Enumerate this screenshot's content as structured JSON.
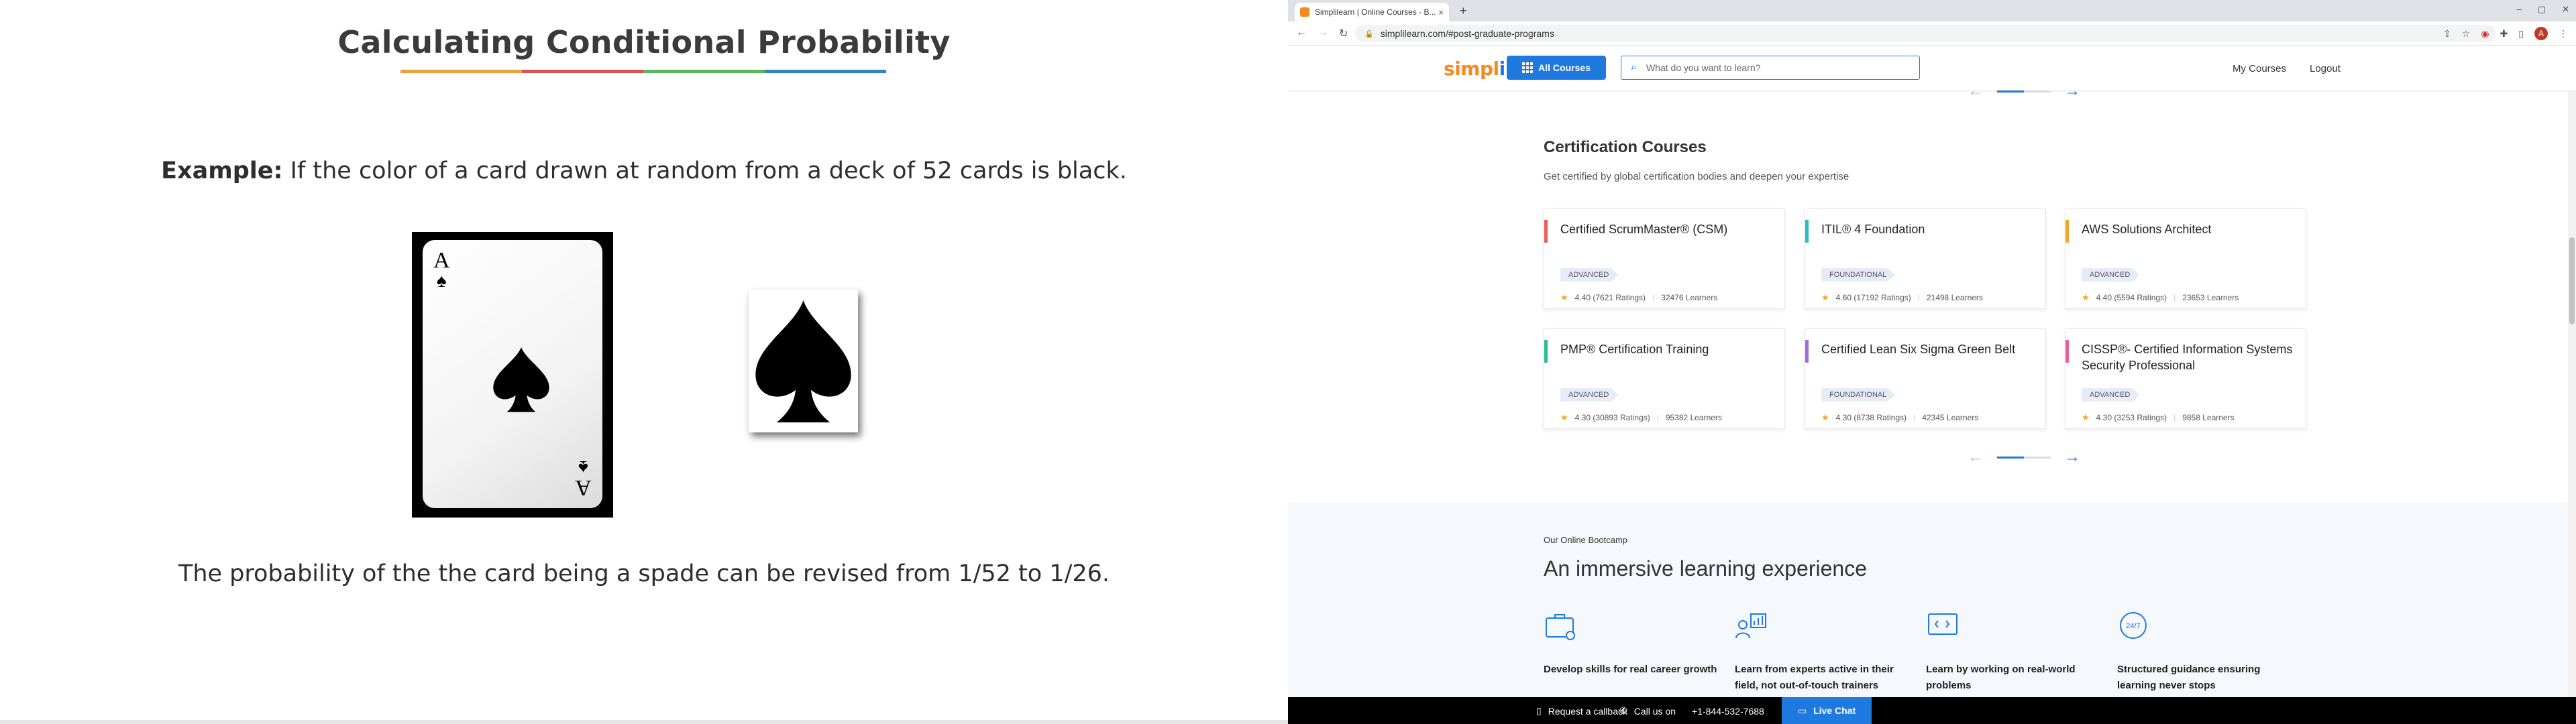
{
  "slide": {
    "title": "Calculating Conditional Probability",
    "example_label": "Example:",
    "example_text": " If the color of a card drawn at random from a deck of 52 cards is black.",
    "card_rank": "A",
    "conclusion": "The probability of the the card being a spade can be revised from 1/52 to 1/26.",
    "underline_colors": [
      "#e8a33d",
      "#d9534f",
      "#5bb85b",
      "#2e86c1"
    ]
  },
  "browser": {
    "tab_title": "Simplilearn | Online Courses - B...",
    "tab_close": "×",
    "new_tab": "+",
    "url": "simplilearn.com/#post-graduate-programs",
    "avatar_letter": "A",
    "window_controls": [
      "–",
      "▢",
      "✕"
    ]
  },
  "header": {
    "logo_text": "simpl",
    "logo_accent": "i",
    "logo_rest": "learn",
    "all_courses": "All Courses",
    "search_placeholder": "What do you want to learn?",
    "my_courses": "My Courses",
    "logout": "Logout"
  },
  "certification": {
    "title": "Certification Courses",
    "subtitle": "Get certified by global certification bodies and deepen your expertise",
    "courses": [
      {
        "name": "Certified ScrumMaster® (CSM)",
        "level": "ADVANCED",
        "rating": "4.40 (7621 Ratings)",
        "learners": "32476 Learners",
        "accent": "#e95f5f"
      },
      {
        "name": "ITIL® 4 Foundation",
        "level": "FOUNDATIONAL",
        "rating": "4.60 (17192 Ratings)",
        "learners": "21498 Learners",
        "accent": "#2bbcc9"
      },
      {
        "name": "AWS Solutions Architect",
        "level": "ADVANCED",
        "rating": "4.40 (5594 Ratings)",
        "learners": "23653 Learners",
        "accent": "#f5a623"
      },
      {
        "name": "PMP® Certification Training",
        "level": "ADVANCED",
        "rating": "4.30 (30893 Ratings)",
        "learners": "95382 Learners",
        "accent": "#2bbc9c"
      },
      {
        "name": "Certified Lean Six Sigma Green Belt",
        "level": "FOUNDATIONAL",
        "rating": "4.30 (8738 Ratings)",
        "learners": "42345 Learners",
        "accent": "#9b6ee0"
      },
      {
        "name": "CISSP®- Certified Information Systems Security Professional",
        "level": "ADVANCED",
        "rating": "4.30 (3253 Ratings)",
        "learners": "9858 Learners",
        "accent": "#e95f9b"
      }
    ]
  },
  "bootcamp": {
    "kicker": "Our Online Bootcamp",
    "title": "An immersive learning experience",
    "features": [
      {
        "text": "Develop skills for real career growth",
        "icon": "briefcase-icon"
      },
      {
        "text": "Learn from experts active in their field, not out-of-touch trainers",
        "icon": "expert-chart-icon"
      },
      {
        "text": "Learn by working on real-world problems",
        "icon": "code-screen-icon"
      },
      {
        "text": "Structured guidance ensuring learning never stops",
        "icon": "24-7-icon"
      }
    ]
  },
  "footer": {
    "request_callback": "Request a callback",
    "call_us": "Call us on",
    "phone": "+1-844-532-7688",
    "live_chat": "Live Chat"
  },
  "colors": {
    "brand_blue": "#1f7ae0",
    "brand_orange": "#f58a1f"
  }
}
